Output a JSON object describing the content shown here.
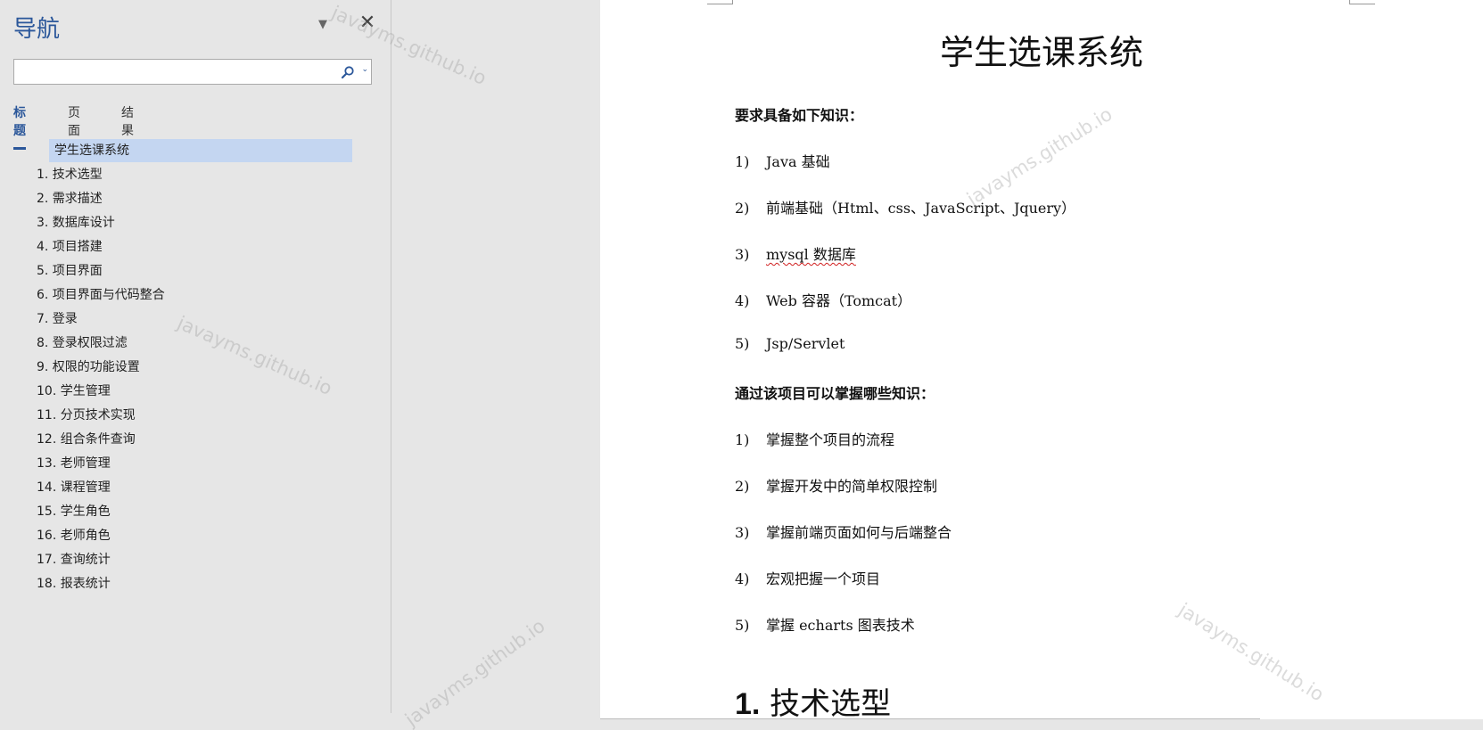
{
  "nav": {
    "title": "导航",
    "search_value": "",
    "search_placeholder": "",
    "tabs": [
      "标题",
      "页面",
      "结果"
    ],
    "active_tab": "标题",
    "headings": [
      "学生选课系统",
      "1. 技术选型",
      "2. 需求描述",
      "3. 数据库设计",
      "4. 项目搭建",
      "5. 项目界面",
      "6. 项目界面与代码整合",
      "7. 登录",
      "8. 登录权限过滤",
      "9. 权限的功能设置",
      "10. 学生管理",
      "11. 分页技术实现",
      "12. 组合条件查询",
      "13. 老师管理",
      "14. 课程管理",
      "15. 学生角色",
      "16. 老师角色",
      "17. 查询统计",
      "18. 报表统计"
    ]
  },
  "document": {
    "title": "学生选课系统",
    "section1_heading": "要求具备如下知识：",
    "section1_items": [
      {
        "num": "1)",
        "text": "Java 基础"
      },
      {
        "num": "2)",
        "text": "前端基础（Html、css、JavaScript、Jquery）"
      },
      {
        "num": "3)",
        "text": "mysql 数据库"
      },
      {
        "num": "4)",
        "text": "Web 容器（Tomcat）"
      },
      {
        "num": "5)",
        "text": "Jsp/Servlet"
      }
    ],
    "section2_heading": "通过该项目可以掌握哪些知识：",
    "section2_items": [
      {
        "num": "1)",
        "text": "掌握整个项目的流程"
      },
      {
        "num": "2)",
        "text": "掌握开发中的简单权限控制"
      },
      {
        "num": "3)",
        "text": "掌握前端页面如何与后端整合"
      },
      {
        "num": "4)",
        "text": "宏观把握一个项目"
      },
      {
        "num": "5)",
        "text": "掌握 echarts 图表技术"
      }
    ],
    "heading1_num": "1.",
    "heading1_text": "技术选型"
  },
  "watermark": "javayms.github.io",
  "colors": {
    "accent": "#2b579a",
    "selected_heading_bg": "#c4d6f1",
    "pane_bg": "#e6e6e6",
    "spellcheck": "#d02020"
  }
}
